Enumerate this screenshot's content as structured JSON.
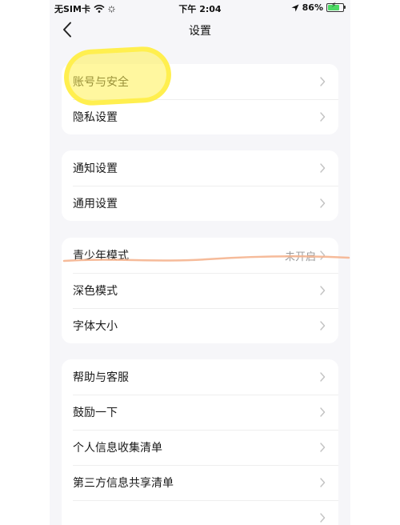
{
  "status_bar": {
    "carrier": "无SIM卡",
    "time": "下午 2:04",
    "battery": "86%"
  },
  "nav": {
    "title": "设置"
  },
  "groups": [
    {
      "items": [
        {
          "label": "账号与安全"
        },
        {
          "label": "隐私设置"
        }
      ]
    },
    {
      "items": [
        {
          "label": "通知设置"
        },
        {
          "label": "通用设置"
        }
      ]
    },
    {
      "items": [
        {
          "label": "青少年模式",
          "value": "未开启"
        },
        {
          "label": "深色模式"
        },
        {
          "label": "字体大小"
        }
      ]
    },
    {
      "items": [
        {
          "label": "帮助与客服"
        },
        {
          "label": "鼓励一下"
        },
        {
          "label": "个人信息收集清单"
        },
        {
          "label": "第三方信息共享清单"
        }
      ]
    }
  ],
  "icons": {
    "back": "chevron-left-icon",
    "row_arrow": "chevron-right-icon",
    "wifi": "wifi-icon",
    "location": "location-arrow-icon",
    "battery": "battery-charging-icon"
  },
  "colors": {
    "highlight_marker": "#fff04f",
    "strike_marker": "#f5b48f",
    "secondary_text": "#999999"
  }
}
